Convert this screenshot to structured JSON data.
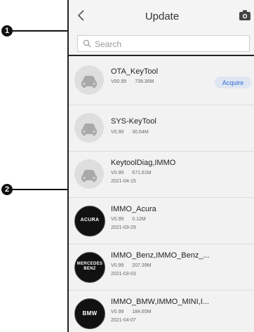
{
  "callouts": [
    "1",
    "2"
  ],
  "header": {
    "title": "Update",
    "search_placeholder": "Search"
  },
  "apps": [
    {
      "name": "OTA_KeyTool",
      "version": "V00.99",
      "size": "739.36M",
      "date": "",
      "badge": "car-icon",
      "badge_text": "",
      "action": "Acquire"
    },
    {
      "name": "SYS-KeyTool",
      "version": "V0.99",
      "size": "30.64M",
      "date": "",
      "badge": "car-icon",
      "badge_text": "",
      "action": ""
    },
    {
      "name": "KeytoolDiag,IMMO",
      "version": "V0.99",
      "size": "671.61M",
      "date": "2021-04-15",
      "badge": "car-icon",
      "badge_text": "",
      "action": ""
    },
    {
      "name": "IMMO_Acura",
      "version": "V0.99",
      "size": "0.12M",
      "date": "2021-03-29",
      "badge": "brand-logo",
      "badge_text": "ACURA",
      "action": ""
    },
    {
      "name": "IMMO_Benz,IMMO_Benz_...",
      "version": "V0.99",
      "size": "207.39M",
      "date": "2021-03-03",
      "badge": "brand-logo",
      "badge_text": "MERCEDES BENZ",
      "action": ""
    },
    {
      "name": "IMMO_BMW,IMMO_MINI,I...",
      "version": "V0.99",
      "size": "184.65M",
      "date": "2021-04-07",
      "badge": "brand-logo",
      "badge_text": "BMW",
      "action": ""
    }
  ],
  "colors": {
    "accent": "#2f6bd1",
    "acquire_bg": "#dfe6f3",
    "list_bg": "#f2f2f2",
    "badge_grey": "#dedede",
    "badge_black": "#111111"
  }
}
